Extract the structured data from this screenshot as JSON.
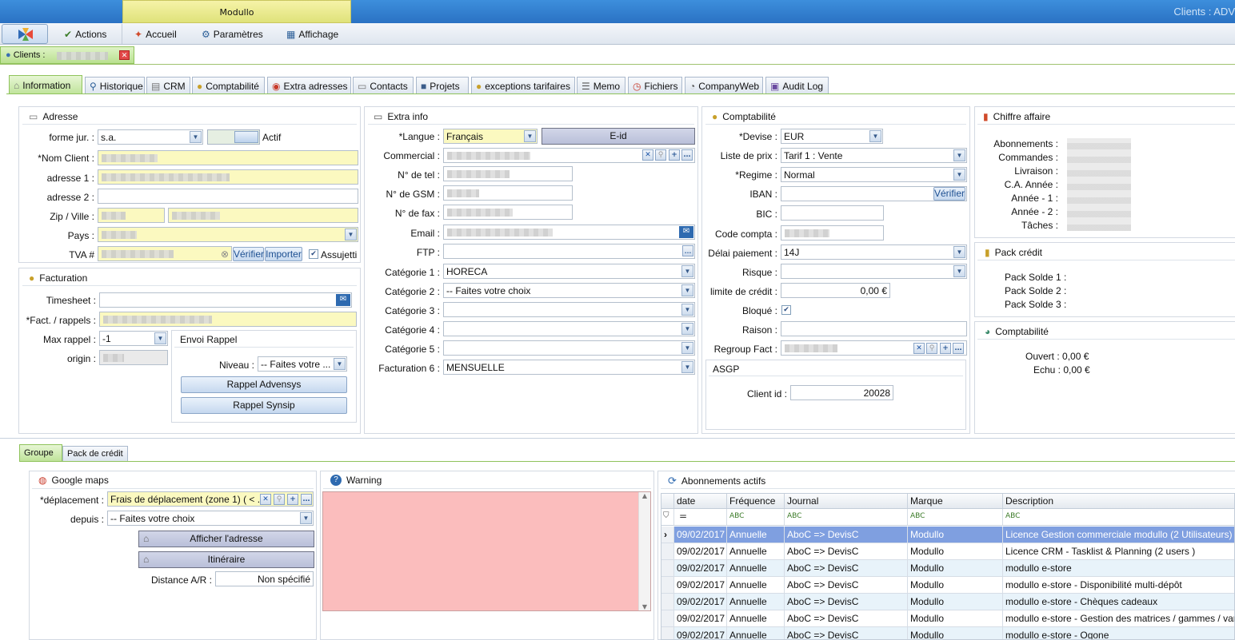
{
  "window": {
    "ribbon_tab": "Modullo",
    "title": "Clients : ADV"
  },
  "menu": {
    "actions": "Actions",
    "accueil": "Accueil",
    "parametres": "Paramètres",
    "affichage": "Affichage"
  },
  "doc_tab": {
    "label": "Clients :"
  },
  "tabs": [
    "Information",
    "Historique",
    "CRM",
    "Comptabilité",
    "Extra adresses",
    "Contacts",
    "Projets",
    "exceptions tarifaires",
    "Memo",
    "Fichiers",
    "CompanyWeb",
    "Audit Log"
  ],
  "adresse": {
    "title": "Adresse",
    "forme_label": "forme jur. :",
    "forme_value": "s.a.",
    "actif_label": "Actif",
    "nom_label": "Nom Client :",
    "adresse1_label": "adresse 1 :",
    "adresse2_label": "adresse 2 :",
    "zip_label": "Zip  / Ville :",
    "pays_label": "Pays :",
    "tva_label": "TVA #",
    "verifier": "Vérifier",
    "importer": "Importer",
    "assujetti": "Assujetti"
  },
  "facturation": {
    "title": "Facturation",
    "timesheet_label": "Timesheet :",
    "fact_label": "Fact. / rappels :",
    "maxrappel_label": "Max rappel  :",
    "maxrappel_value": "-1",
    "origin_label": "origin :",
    "envoi_title": "Envoi Rappel",
    "niveau_label": "Niveau :",
    "niveau_value": "-- Faites votre ...",
    "btn_advensys": "Rappel Advensys",
    "btn_synsip": "Rappel Synsip"
  },
  "extra": {
    "title": "Extra info",
    "langue_label": "Langue :",
    "langue_value": "Français",
    "eid": "E-id",
    "commercial_label": "Commercial :",
    "tel_label": "N° de tel :",
    "gsm_label": "N° de GSM :",
    "fax_label": "N° de fax :",
    "email_label": "Email :",
    "ftp_label": "FTP :",
    "cat1_label": "Catégorie 1 :",
    "cat1_value": "HORECA",
    "cat2_label": "Catégorie 2 :",
    "cat2_value": "-- Faites votre choix",
    "cat3_label": "Catégorie 3 :",
    "cat4_label": "Catégorie 4 :",
    "cat5_label": "Catégorie 5 :",
    "fact6_label": "Facturation 6 :",
    "fact6_value": "MENSUELLE"
  },
  "compta": {
    "title": "Comptabilité",
    "devise_label": "Devise :",
    "devise_value": "EUR",
    "prix_label": "Liste de prix :",
    "prix_value": "Tarif 1 : Vente",
    "regime_label": "Regime :",
    "regime_value": "Normal",
    "iban_label": "IBAN :",
    "iban_verifier": "Vérifier",
    "bic_label": "BIC :",
    "code_label": "Code compta :",
    "delai_label": "Délai paiement :",
    "delai_value": "14J",
    "risque_label": "Risque :",
    "limite_label": "limite de crédit :",
    "limite_value": "0,00 €",
    "bloque_label": "Bloqué :",
    "raison_label": "Raison :",
    "regroup_label": "Regroup Fact :",
    "asgp_title": "ASGP",
    "clientid_label": "Client id :",
    "clientid_value": "20028"
  },
  "chiffre": {
    "title": "Chiffre affaire",
    "labels": [
      "Abonnements :",
      "Commandes :",
      "Livraison :",
      "C.A. Année :",
      "Année - 1 :",
      "Année - 2 :",
      "Tâches :"
    ]
  },
  "pack": {
    "title": "Pack crédit",
    "labels": [
      "Pack Solde 1 :",
      "Pack Solde 2 :",
      "Pack Solde 3 :"
    ]
  },
  "compta2": {
    "title": "Comptabilité",
    "ouvert": "Ouvert : 0,00 €",
    "echu": "Echu : 0,00 €"
  },
  "bottom_tabs": [
    "Groupe",
    "Pack de crédit"
  ],
  "gmaps": {
    "title": "Google maps",
    "deplacement_label": "déplacement :",
    "deplacement_value": "Frais de déplacement (zone 1) ( < ...",
    "depuis_label": "depuis :",
    "depuis_value": "-- Faites votre choix",
    "afficher": "Afficher l'adresse",
    "itineraire": "Itinéraire",
    "distance_label": "Distance A/R :",
    "distance_value": "Non spécifié"
  },
  "warning": {
    "title": "Warning"
  },
  "abonnements": {
    "title": "Abonnements actifs",
    "columns": [
      "date",
      "Fréquence",
      "Journal",
      "Marque",
      "Description"
    ],
    "filter_eq": "=",
    "filter_abc": "ABC",
    "rows": [
      [
        "09/02/2017",
        "Annuelle",
        "AboC => DevisC",
        "Modullo",
        "Licence Gestion commerciale modullo (2 Utilisateurs)"
      ],
      [
        "09/02/2017",
        "Annuelle",
        "AboC => DevisC",
        "Modullo",
        "Licence CRM - Tasklist & Planning (2 users )"
      ],
      [
        "09/02/2017",
        "Annuelle",
        "AboC => DevisC",
        "Modullo",
        "modullo e-store"
      ],
      [
        "09/02/2017",
        "Annuelle",
        "AboC => DevisC",
        "Modullo",
        "modullo e-store - Disponibilité multi-dépôt"
      ],
      [
        "09/02/2017",
        "Annuelle",
        "AboC => DevisC",
        "Modullo",
        "modullo e-store - Chèques cadeaux"
      ],
      [
        "09/02/2017",
        "Annuelle",
        "AboC => DevisC",
        "Modullo",
        "modullo e-store - Gestion des matrices / gammes / variants"
      ],
      [
        "09/02/2017",
        "Annuelle",
        "AboC => DevisC",
        "Modullo",
        "modullo e-store - Ogone"
      ]
    ]
  }
}
